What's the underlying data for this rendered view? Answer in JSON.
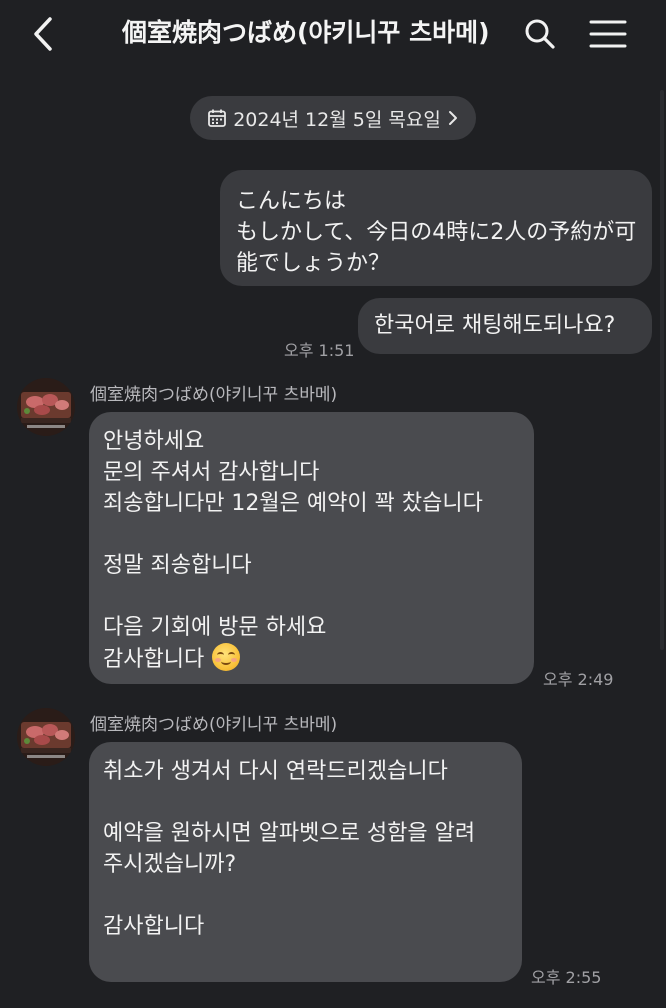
{
  "header": {
    "title": "個室焼肉つばめ(야키니꾸 츠바메)"
  },
  "date_pill": {
    "label": "2024년 12월 5일 목요일"
  },
  "messages": {
    "out1": {
      "lines": [
        "こんにちは",
        "もしかして、今日の4時に2人の予約が可",
        "能でしょうか？"
      ]
    },
    "out2": {
      "lines": [
        "한국어로 채팅해도되나요?"
      ],
      "time": "오후 1:51"
    },
    "in1": {
      "sender": "個室焼肉つばめ(야키니꾸 츠바메)",
      "lines": [
        "안녕하세요",
        "문의 주셔서 감사합니다",
        "죄송합니다만 12월은 예약이 꽉 찼습니다",
        "",
        "정말 죄송합니다",
        "",
        "다음 기회에 방문 하세요",
        "감사합니다"
      ],
      "time": "오후 2:49"
    },
    "in2": {
      "sender": "個室焼肉つばめ(야키니꾸 츠바메)",
      "lines": [
        "취소가 생겨서 다시 연락드리겠습니다",
        "",
        "예약을 원하시면 알파벳으로 성함을 알려",
        "주시겠습니까?",
        "",
        "감사합니다"
      ],
      "time": "오후 2:55"
    }
  },
  "icons": {
    "back": "chevron-left-icon",
    "search": "search-icon",
    "menu": "hamburger-menu-icon",
    "calendar": "calendar-icon",
    "chevron": "chevron-right-icon",
    "emoji": "smiling-face-emoji"
  },
  "colors": {
    "background": "#1f2023",
    "bubble_out": "#3a3b3f",
    "bubble_in": "#4a4b4f",
    "text": "#f2f2f2",
    "meta": "#a0a0a4"
  }
}
